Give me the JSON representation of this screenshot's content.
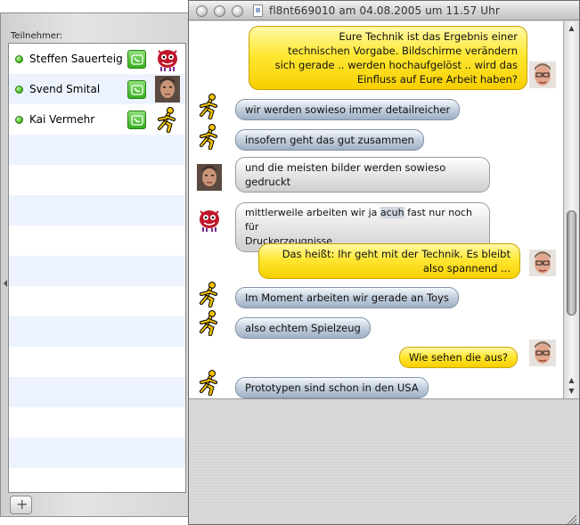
{
  "drawer": {
    "title": "Teilnehmer:",
    "participants": [
      {
        "name": "Steffen Sauerteig",
        "avatar": "purple-monster-avatar"
      },
      {
        "name": "Svend Smital",
        "avatar": "man-photo-avatar"
      },
      {
        "name": "Kai Vermehr",
        "avatar": "aim-running-man-avatar"
      }
    ],
    "add_label": "+",
    "call_icon": "phone-video-icon",
    "status_color": "#3fbf1f"
  },
  "window": {
    "title": "fl8nt669010 am 04.08.2005 um 11.57 Uhr",
    "traffic_lights": [
      "close-icon",
      "minimize-icon",
      "zoom-icon"
    ]
  },
  "messages": [
    {
      "side": "right",
      "style": "yellow",
      "sender": "man-glasses-avatar",
      "text": "Eure Technik ist das Ergebnis einer\ntechnischen Vorgabe. Bildschirme verändern\nsich gerade .. werden hochaufgelöst .. wird das\nEinfluss auf Eure Arbeit haben?"
    },
    {
      "side": "left",
      "style": "blue",
      "sender": "aim-running-man-avatar",
      "text": "wir werden sowieso immer detailreicher"
    },
    {
      "side": "left",
      "style": "blue",
      "sender": "aim-running-man-avatar",
      "text": "insofern geht das gut zusammen"
    },
    {
      "side": "left",
      "style": "gray",
      "sender": "man-photo-avatar",
      "text": "und die meisten bilder werden sowieso\ngedruckt"
    },
    {
      "side": "left",
      "style": "gray",
      "sender": "purple-monster-avatar",
      "text_parts": [
        "mittlerweile arbeiten wir ja ",
        "acuh",
        " fast nur noch für\nDruckerzeugnisse"
      ]
    },
    {
      "side": "right",
      "style": "yellow",
      "sender": "man-glasses-avatar",
      "text": "Das heißt: Ihr geht mit der Technik. Es bleibt\nalso spannend ..."
    },
    {
      "side": "left",
      "style": "blue",
      "sender": "aim-running-man-avatar",
      "text": "Im Moment arbeiten wir gerade an Toys"
    },
    {
      "side": "left",
      "style": "blue",
      "sender": "aim-running-man-avatar",
      "text": "also echtem Spielzeug"
    },
    {
      "side": "right",
      "style": "yellow",
      "sender": "man-glasses-avatar",
      "text": "Wie sehen die aus?"
    },
    {
      "side": "left",
      "style": "blue",
      "sender": "aim-running-man-avatar",
      "text": "Prototypen sind schon in den USA"
    }
  ]
}
